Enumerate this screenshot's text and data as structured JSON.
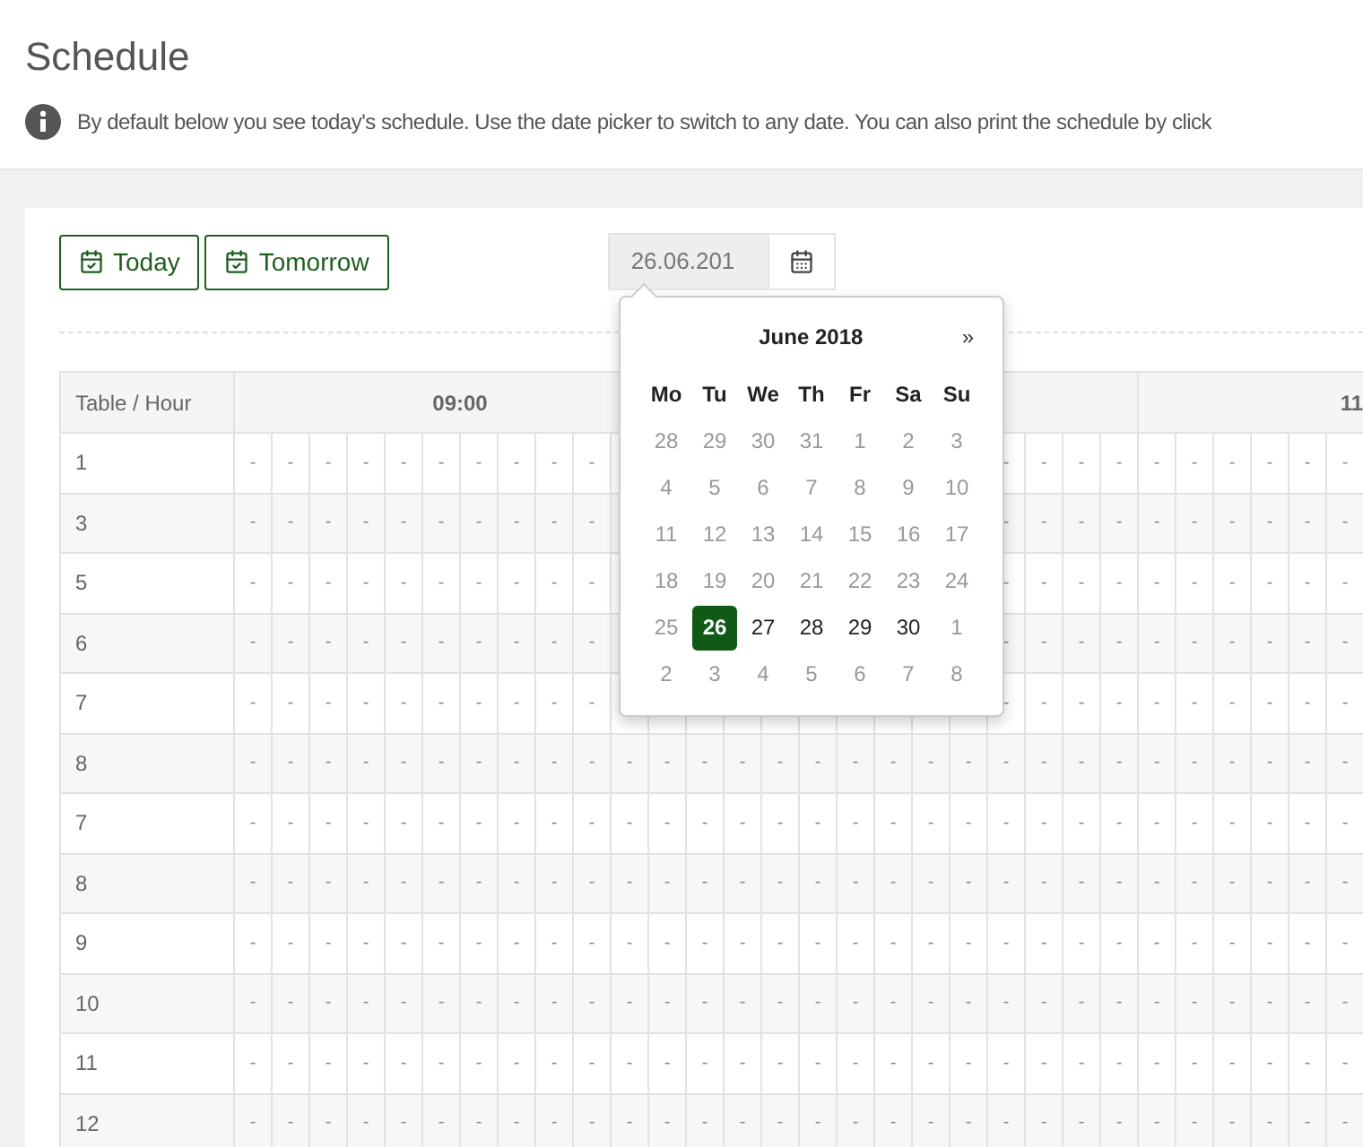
{
  "page": {
    "title": "Schedule",
    "info": "By default below you see today's schedule. Use the date picker to switch to any date. You can also print the schedule by click"
  },
  "toolbar": {
    "buttons": [
      "Today",
      "Tomorrow"
    ],
    "date_value": "26.06.201"
  },
  "datepicker": {
    "month": "June 2018",
    "next": "»",
    "weekdays": [
      "Mo",
      "Tu",
      "We",
      "Th",
      "Fr",
      "Sa",
      "Su"
    ],
    "days": [
      {
        "label": "28",
        "disabled": true,
        "selected": false
      },
      {
        "label": "29",
        "disabled": true,
        "selected": false
      },
      {
        "label": "30",
        "disabled": true,
        "selected": false
      },
      {
        "label": "31",
        "disabled": true,
        "selected": false
      },
      {
        "label": "1",
        "disabled": true,
        "selected": false
      },
      {
        "label": "2",
        "disabled": true,
        "selected": false
      },
      {
        "label": "3",
        "disabled": true,
        "selected": false
      },
      {
        "label": "4",
        "disabled": true,
        "selected": false
      },
      {
        "label": "5",
        "disabled": true,
        "selected": false
      },
      {
        "label": "6",
        "disabled": true,
        "selected": false
      },
      {
        "label": "7",
        "disabled": true,
        "selected": false
      },
      {
        "label": "8",
        "disabled": true,
        "selected": false
      },
      {
        "label": "9",
        "disabled": true,
        "selected": false
      },
      {
        "label": "10",
        "disabled": true,
        "selected": false
      },
      {
        "label": "11",
        "disabled": true,
        "selected": false
      },
      {
        "label": "12",
        "disabled": true,
        "selected": false
      },
      {
        "label": "13",
        "disabled": true,
        "selected": false
      },
      {
        "label": "14",
        "disabled": true,
        "selected": false
      },
      {
        "label": "15",
        "disabled": true,
        "selected": false
      },
      {
        "label": "16",
        "disabled": true,
        "selected": false
      },
      {
        "label": "17",
        "disabled": true,
        "selected": false
      },
      {
        "label": "18",
        "disabled": true,
        "selected": false
      },
      {
        "label": "19",
        "disabled": true,
        "selected": false
      },
      {
        "label": "20",
        "disabled": true,
        "selected": false
      },
      {
        "label": "21",
        "disabled": true,
        "selected": false
      },
      {
        "label": "22",
        "disabled": true,
        "selected": false
      },
      {
        "label": "23",
        "disabled": true,
        "selected": false
      },
      {
        "label": "24",
        "disabled": true,
        "selected": false
      },
      {
        "label": "25",
        "disabled": true,
        "selected": false
      },
      {
        "label": "26",
        "disabled": false,
        "selected": true
      },
      {
        "label": "27",
        "disabled": false,
        "selected": false
      },
      {
        "label": "28",
        "disabled": false,
        "selected": false
      },
      {
        "label": "29",
        "disabled": false,
        "selected": false
      },
      {
        "label": "30",
        "disabled": false,
        "selected": false
      },
      {
        "label": "1",
        "disabled": true,
        "selected": false
      },
      {
        "label": "2",
        "disabled": true,
        "selected": false
      },
      {
        "label": "3",
        "disabled": true,
        "selected": false
      },
      {
        "label": "4",
        "disabled": true,
        "selected": false
      },
      {
        "label": "5",
        "disabled": true,
        "selected": false
      },
      {
        "label": "6",
        "disabled": true,
        "selected": false
      },
      {
        "label": "7",
        "disabled": true,
        "selected": false
      },
      {
        "label": "8",
        "disabled": true,
        "selected": false
      }
    ]
  },
  "table": {
    "corner": "Table / Hour",
    "hours": [
      "09:00",
      "11"
    ],
    "rows": [
      {
        "label": "1",
        "cells": [
          "-",
          "-",
          "-",
          "-",
          "-",
          "-",
          "-",
          "-",
          "-",
          "-",
          null,
          null,
          null,
          null,
          null,
          null,
          null,
          null,
          null,
          null,
          "-",
          "-",
          "-",
          "-",
          "-",
          "-",
          "-",
          "-",
          "-",
          "-"
        ]
      },
      {
        "label": "3",
        "cells": [
          "-",
          "-",
          "-",
          "-",
          "-",
          "-",
          "-",
          "-",
          "-",
          "-",
          null,
          null,
          null,
          null,
          null,
          null,
          null,
          null,
          null,
          null,
          "-",
          "-",
          "-",
          "-",
          "-",
          "-",
          "-",
          "-",
          "-",
          "-"
        ]
      },
      {
        "label": "5",
        "cells": [
          "-",
          "-",
          "-",
          "-",
          "-",
          "-",
          "-",
          "-",
          "-",
          "-",
          null,
          null,
          null,
          null,
          null,
          null,
          null,
          null,
          null,
          null,
          "-",
          "-",
          "-",
          "-",
          "-",
          "-",
          "-",
          "-",
          "-",
          "-"
        ]
      },
      {
        "label": "6",
        "cells": [
          "-",
          "-",
          "-",
          "-",
          "-",
          "-",
          "-",
          "-",
          "-",
          "-",
          null,
          null,
          null,
          null,
          null,
          null,
          null,
          null,
          null,
          null,
          "-",
          "-",
          "-",
          "-",
          "-",
          "-",
          "-",
          "-",
          "-",
          "-"
        ]
      },
      {
        "label": "7",
        "cells": [
          "-",
          "-",
          "-",
          "-",
          "-",
          "-",
          "-",
          "-",
          "-",
          "-",
          null,
          null,
          null,
          null,
          null,
          null,
          null,
          null,
          null,
          null,
          "-",
          "-",
          "-",
          "-",
          "-",
          "-",
          "-",
          "-",
          "-",
          "-"
        ]
      },
      {
        "label": "8",
        "cells": [
          "-",
          "-",
          "-",
          "-",
          "-",
          "-",
          "-",
          "-",
          "-",
          "-",
          "-",
          "-",
          "-",
          "-",
          "-",
          "-",
          "-",
          "-",
          "-",
          "-",
          "-",
          "-",
          "-",
          "-",
          "-",
          "-",
          "-",
          "-",
          "-",
          "-"
        ]
      },
      {
        "label": "7",
        "cells": [
          "-",
          "-",
          "-",
          "-",
          "-",
          "-",
          "-",
          "-",
          "-",
          "-",
          "-",
          "-",
          "-",
          "-",
          "-",
          "-",
          "-",
          "-",
          "-",
          "-",
          "-",
          "-",
          "-",
          "-",
          "-",
          "-",
          "-",
          "-",
          "-",
          "-"
        ]
      },
      {
        "label": "8",
        "cells": [
          "-",
          "-",
          "-",
          "-",
          "-",
          "-",
          "-",
          "-",
          "-",
          "-",
          "-",
          "-",
          "-",
          "-",
          "-",
          "-",
          "-",
          "-",
          "-",
          "-",
          "-",
          "-",
          "-",
          "-",
          "-",
          "-",
          "-",
          "-",
          "-",
          "-"
        ]
      },
      {
        "label": "9",
        "cells": [
          "-",
          "-",
          "-",
          "-",
          "-",
          "-",
          "-",
          "-",
          "-",
          "-",
          "-",
          "-",
          "-",
          "-",
          "-",
          "-",
          "-",
          "-",
          "-",
          "-",
          "-",
          "-",
          "-",
          "-",
          "-",
          "-",
          "-",
          "-",
          "-",
          "-"
        ]
      },
      {
        "label": "10",
        "cells": [
          "-",
          "-",
          "-",
          "-",
          "-",
          "-",
          "-",
          "-",
          "-",
          "-",
          "-",
          "-",
          "-",
          "-",
          "-",
          "-",
          "-",
          "-",
          "-",
          "-",
          "-",
          "-",
          "-",
          "-",
          "-",
          "-",
          "-",
          "-",
          "-",
          "-"
        ]
      },
      {
        "label": "11",
        "cells": [
          "-",
          "-",
          "-",
          "-",
          "-",
          "-",
          "-",
          "-",
          "-",
          "-",
          "-",
          "-",
          "-",
          "-",
          "-",
          "-",
          "-",
          "-",
          "-",
          "-",
          "-",
          "-",
          "-",
          "-",
          "-",
          "-",
          "-",
          "-",
          "-",
          "-"
        ]
      },
      {
        "label": "12",
        "cells": [
          "-",
          "-",
          "-",
          "-",
          "-",
          "-",
          "-",
          "-",
          "-",
          "-",
          "-",
          "-",
          "-",
          "-",
          "-",
          "-",
          "-",
          "-",
          "-",
          "-",
          "-",
          "-",
          "-",
          "-",
          "-",
          "-",
          "-",
          "-",
          "-",
          "-"
        ]
      }
    ]
  }
}
